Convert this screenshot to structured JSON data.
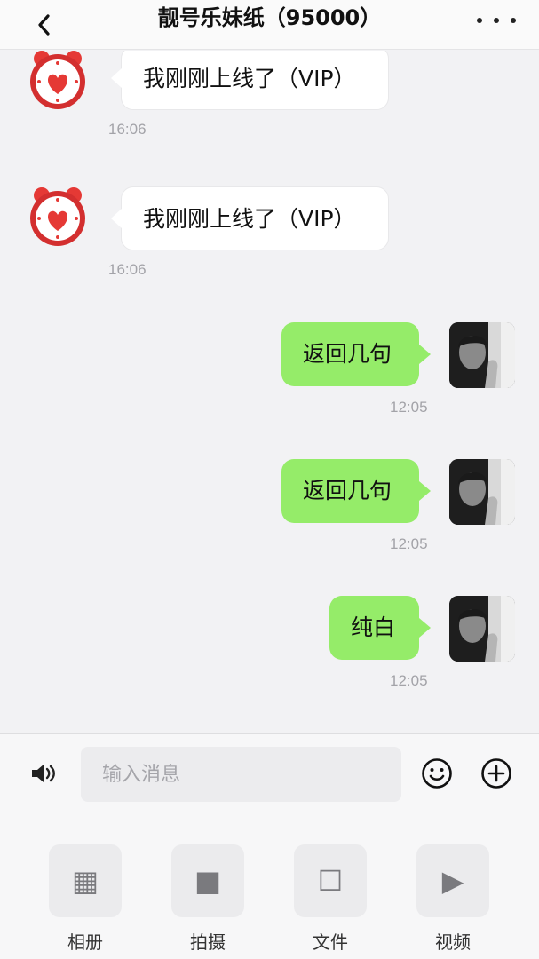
{
  "header": {
    "back_icon": "chevron-left-icon",
    "title": "靓号乐妹纸（95000）",
    "more_icon": "more-dots-icon"
  },
  "messages": [
    {
      "direction": "in",
      "avatar": "alarm-clock-heart-avatar",
      "text": "我刚刚上线了（VIP）",
      "time": "16:06"
    },
    {
      "direction": "in",
      "avatar": "alarm-clock-heart-avatar",
      "text": "我刚刚上线了（VIP）",
      "time": "16:06"
    },
    {
      "direction": "out",
      "avatar": "user-photo-avatar",
      "text": "返回几句",
      "time": "12:05"
    },
    {
      "direction": "out",
      "avatar": "user-photo-avatar",
      "text": "返回几句",
      "time": "12:05"
    },
    {
      "direction": "out",
      "avatar": "user-photo-avatar",
      "text": "纯白",
      "time": "12:05"
    }
  ],
  "composer": {
    "voice_icon": "speaker-icon",
    "placeholder": "输入消息",
    "value": "",
    "emoji_icon": "smiley-icon",
    "plus_icon": "plus-circle-icon"
  },
  "toolbar": [
    {
      "label": "相册",
      "icon": "grid-icon",
      "glyph": "▦"
    },
    {
      "label": "拍摄",
      "icon": "square-filled-icon",
      "glyph": "■"
    },
    {
      "label": "文件",
      "icon": "square-outline-icon",
      "glyph": "☐"
    },
    {
      "label": "视频",
      "icon": "play-icon",
      "glyph": "▶"
    }
  ],
  "colors": {
    "background": "#f2f2f4",
    "outgoing_bubble": "#95ec69",
    "incoming_bubble": "#ffffff",
    "timestamp": "#a3a3a8"
  }
}
